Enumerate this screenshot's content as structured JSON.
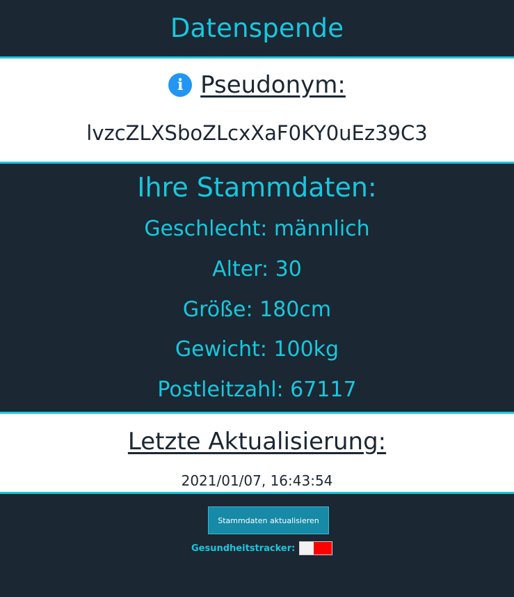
{
  "header": {
    "title": "Datenspende"
  },
  "pseudonym": {
    "title": "Pseudonym:",
    "icon": "info-icon",
    "value": "lvzcZLXSboZLcxXaF0KY0uEz39C3"
  },
  "stammdaten": {
    "title": "Ihre Stammdaten:",
    "rows": [
      "Geschlecht: männlich",
      "Alter: 30",
      "Größe: 180cm",
      "Gewicht: 100kg",
      "Postleitzahl: 67117"
    ]
  },
  "update": {
    "title": "Letzte Aktualisierung:",
    "timestamp": "2021/01/07, 16:43:54"
  },
  "actions": {
    "update_button_label": "Stammdaten aktualisieren",
    "tracker_label": "Gesundheitstracker:",
    "tracker_enabled": false
  },
  "colors": {
    "background": "#1b2733",
    "accent": "#17c8de",
    "info_icon": "#2196f3",
    "button": "#168aa6",
    "toggle_off": "#ff0000"
  }
}
